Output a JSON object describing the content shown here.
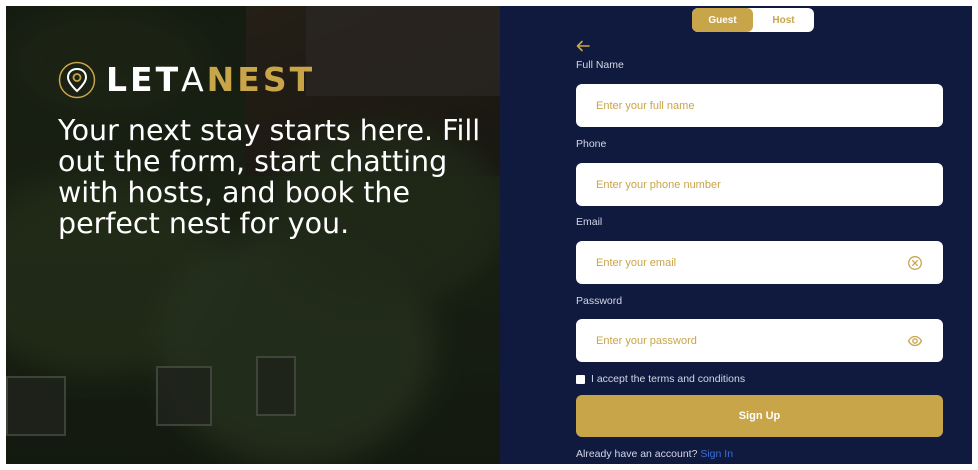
{
  "brand": {
    "name_part1": "LET",
    "name_part2": "A",
    "name_part3": "NEST",
    "accent_color": "#c9a54a",
    "logo_icon": "map-pin-heart-icon"
  },
  "hero": {
    "tagline": "Your next stay starts here. Fill out the form, start chatting with hosts, and book the perfect nest for you."
  },
  "role_toggle": {
    "guest_label": "Guest",
    "host_label": "Host",
    "selected": "Guest"
  },
  "form": {
    "back_icon": "arrow-left-icon",
    "full_name": {
      "label": "Full Name",
      "placeholder": "Enter your full name",
      "value": ""
    },
    "phone": {
      "label": "Phone",
      "placeholder": "Enter your phone number",
      "value": ""
    },
    "email": {
      "label": "Email",
      "placeholder": "Enter your email",
      "value": "",
      "icon": "clear-circle-icon"
    },
    "password": {
      "label": "Password",
      "placeholder": "Enter your password",
      "value": "",
      "icon": "eye-icon"
    },
    "terms_label": "I accept the terms and conditions",
    "terms_checked": false,
    "submit_label": "Sign Up",
    "signin_prompt": "Already have an account?",
    "signin_link": "Sign In"
  },
  "colors": {
    "panel_bg": "#101a3f",
    "gold": "#c9a54a",
    "link": "#3d6fd6"
  }
}
